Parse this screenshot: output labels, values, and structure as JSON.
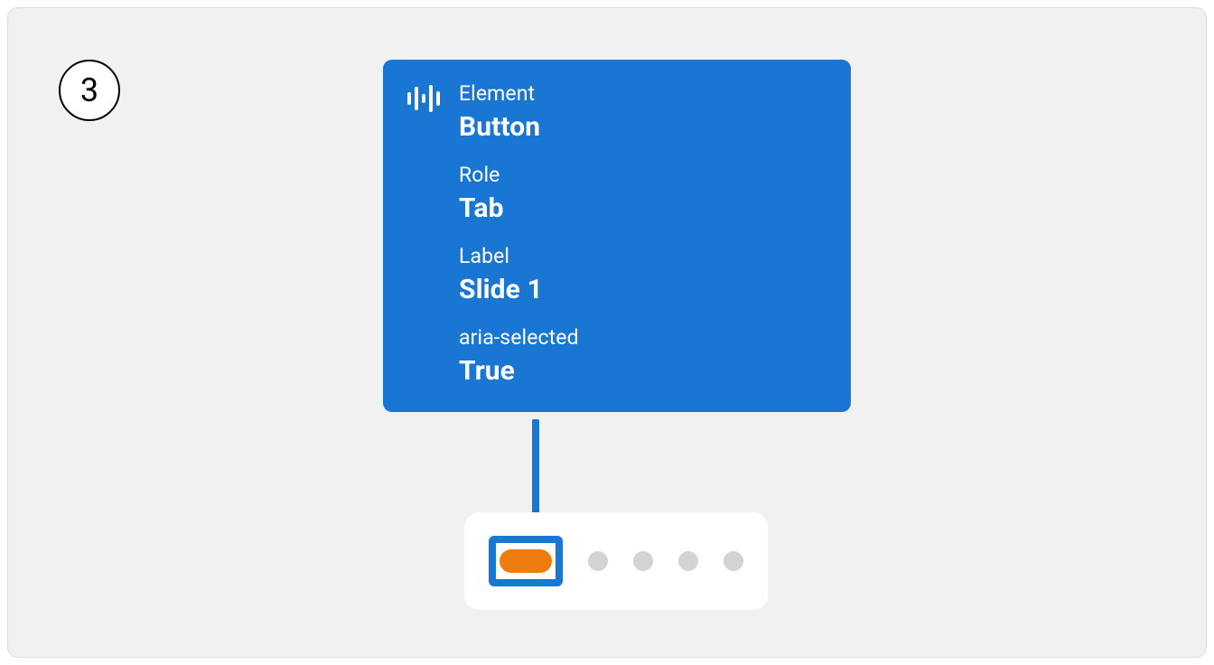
{
  "step_number": "3",
  "colors": {
    "callout_bg": "#1976d2",
    "accent": "#ed7d0e",
    "dot_inactive": "#d3d3d3",
    "canvas_bg": "#f1f1f1"
  },
  "callout": {
    "icon": "audio-bars-icon",
    "props": [
      {
        "label": "Element",
        "value": "Button"
      },
      {
        "label": "Role",
        "value": "Tab"
      },
      {
        "label": "Label",
        "value": "Slide 1"
      },
      {
        "label": "aria-selected",
        "value": "True"
      }
    ]
  },
  "pagination": {
    "total": 5,
    "selected_index": 0
  }
}
